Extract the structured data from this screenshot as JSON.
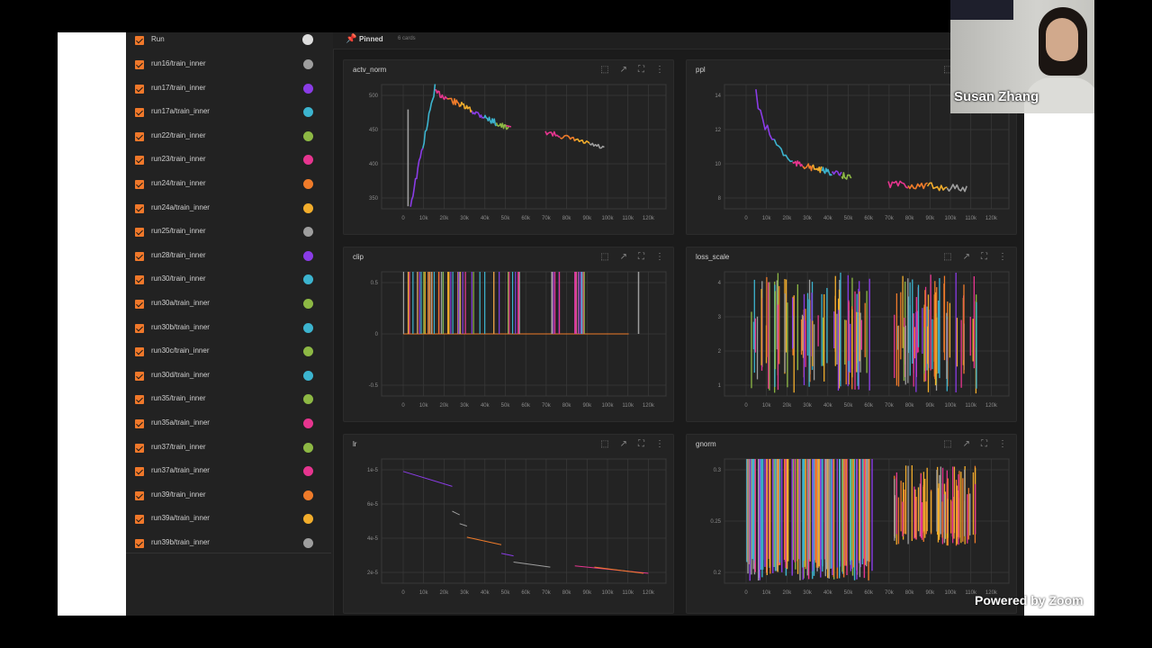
{
  "sidebar": {
    "header": "Run",
    "runs": [
      {
        "name": "run16/train_inner",
        "color": "#9e9e9e"
      },
      {
        "name": "run17/train_inner",
        "color": "#8a3ce6"
      },
      {
        "name": "run17a/train_inner",
        "color": "#3cb4cf"
      },
      {
        "name": "run22/train_inner",
        "color": "#8db844"
      },
      {
        "name": "run23/train_inner",
        "color": "#e6358f"
      },
      {
        "name": "run24/train_inner",
        "color": "#ef7b2a"
      },
      {
        "name": "run24a/train_inner",
        "color": "#f2ad2c"
      },
      {
        "name": "run25/train_inner",
        "color": "#9e9e9e"
      },
      {
        "name": "run28/train_inner",
        "color": "#8a3ce6"
      },
      {
        "name": "run30/train_inner",
        "color": "#3cb4cf"
      },
      {
        "name": "run30a/train_inner",
        "color": "#8db844"
      },
      {
        "name": "run30b/train_inner",
        "color": "#3cb4cf"
      },
      {
        "name": "run30c/train_inner",
        "color": "#8db844"
      },
      {
        "name": "run30d/train_inner",
        "color": "#3cb4cf"
      },
      {
        "name": "run35/train_inner",
        "color": "#8db844"
      },
      {
        "name": "run35a/train_inner",
        "color": "#e6358f"
      },
      {
        "name": "run37/train_inner",
        "color": "#8db844"
      },
      {
        "name": "run37a/train_inner",
        "color": "#e6358f"
      },
      {
        "name": "run39/train_inner",
        "color": "#ef7b2a"
      },
      {
        "name": "run39a/train_inner",
        "color": "#f2ad2c"
      },
      {
        "name": "run39b/train_inner",
        "color": "#9e9e9e"
      }
    ]
  },
  "pinned": {
    "label": "Pinned",
    "count": "6 cards"
  },
  "cards": [
    {
      "title": "actv_norm",
      "ylabels": [
        "500",
        "450",
        "400",
        "350"
      ]
    },
    {
      "title": "ppl",
      "ylabels": [
        "14",
        "12",
        "10",
        "8"
      ]
    },
    {
      "title": "clip",
      "ylabels": [
        "0.5",
        "0",
        "-0.5"
      ]
    },
    {
      "title": "loss_scale",
      "ylabels": [
        "4",
        "3",
        "2",
        "1"
      ]
    },
    {
      "title": "lr",
      "ylabels": [
        "1e-5",
        "6e-5",
        "4e-5",
        "2e-5"
      ]
    },
    {
      "title": "gnorm",
      "ylabels": [
        "0.3",
        "0.25",
        "0.2"
      ]
    }
  ],
  "xticks": [
    "0",
    "10k",
    "20k",
    "30k",
    "40k",
    "50k",
    "60k",
    "70k",
    "80k",
    "90k",
    "100k",
    "110k",
    "120k"
  ],
  "zoom": {
    "participant": "Susan Zhang",
    "watermark": "Powered by Zoom"
  },
  "icons": [
    "palette-icon",
    "pin-icon",
    "fit-icon",
    "pin-card-icon",
    "fullscreen-icon",
    "more-vert-icon"
  ]
}
